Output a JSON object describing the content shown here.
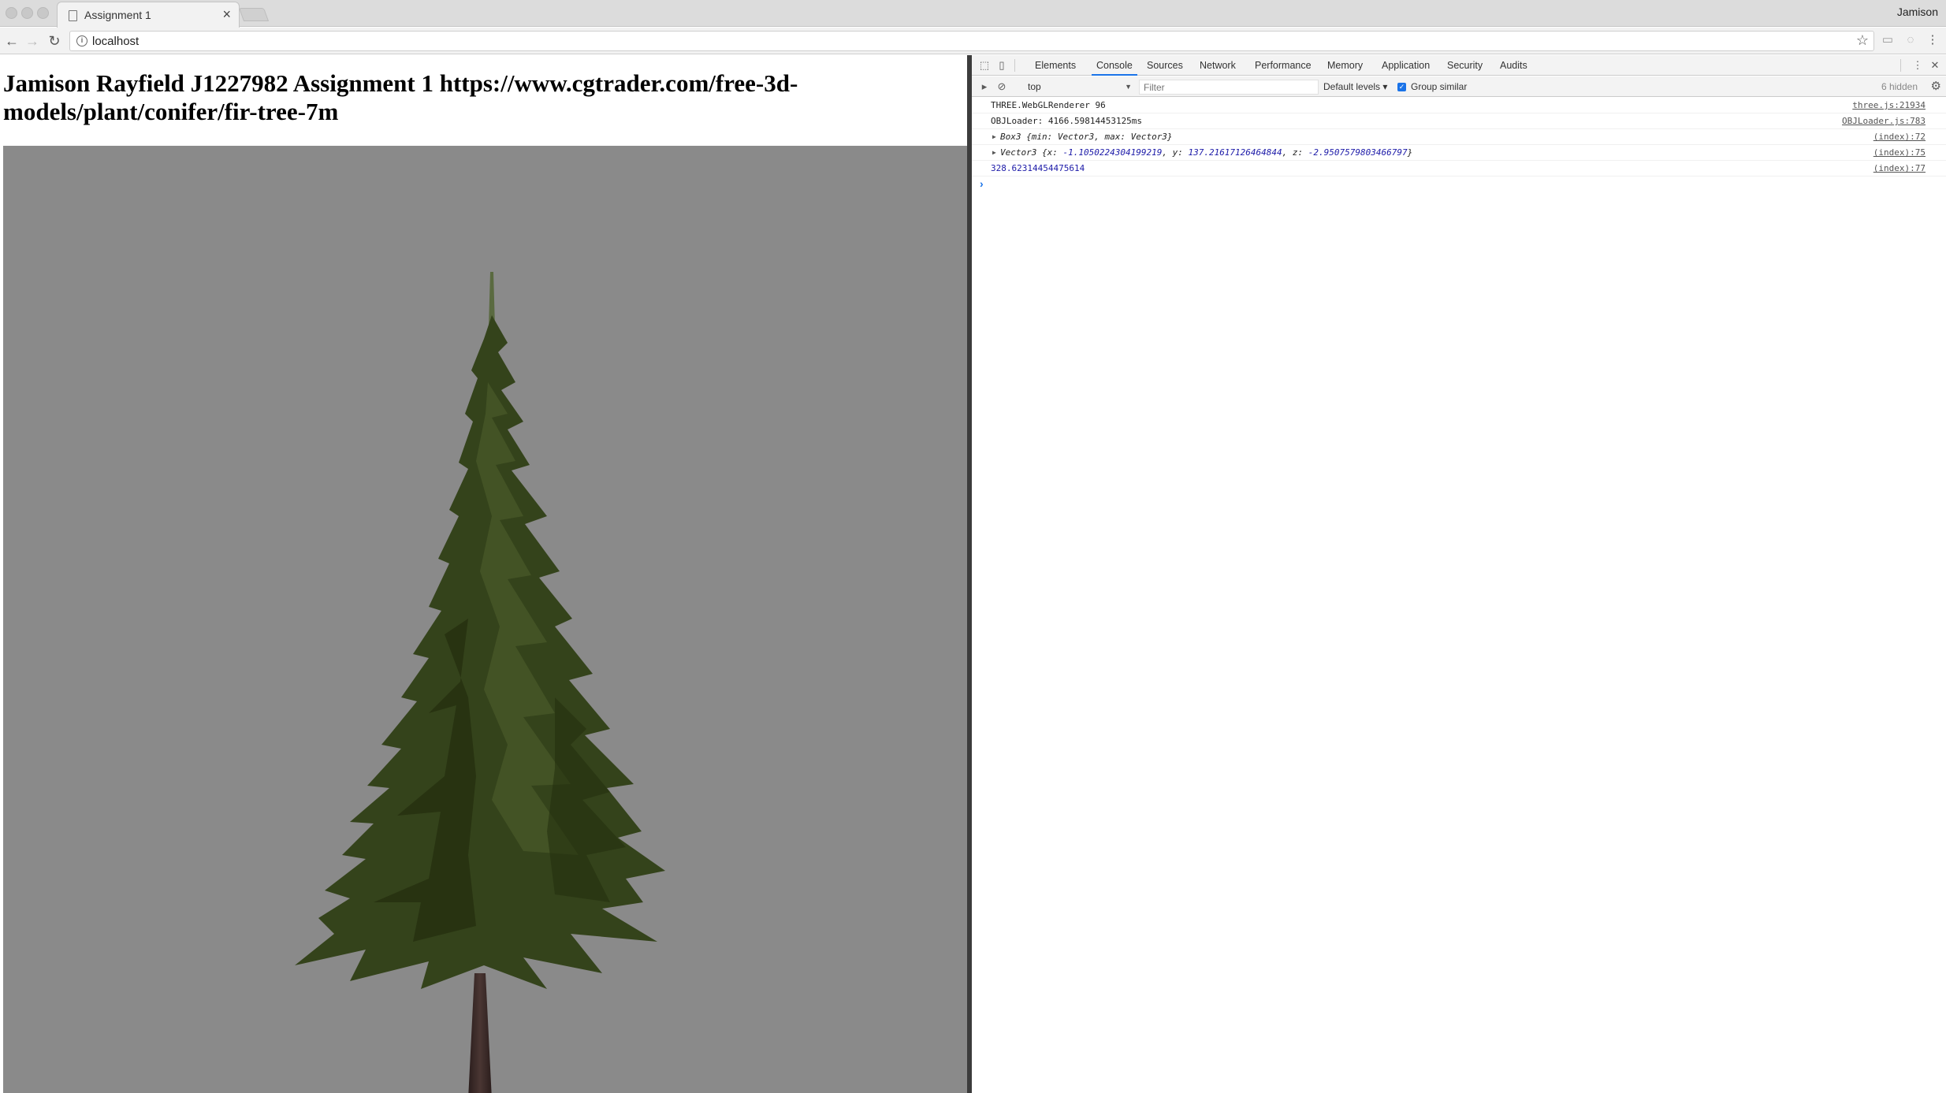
{
  "browser": {
    "tab_title": "Assignment 1",
    "tab_close": "×",
    "profile_name": "Jamison",
    "url": "localhost"
  },
  "page": {
    "heading": "Jamison Rayfield J1227982 Assignment 1 https://www.cgtrader.com/free-3d-models/plant/conifer/fir-tree-7m",
    "viewport_background": "#8a8a8a"
  },
  "devtools": {
    "tabs": [
      "Elements",
      "Console",
      "Sources",
      "Network",
      "Performance",
      "Memory",
      "Application",
      "Security",
      "Audits"
    ],
    "active_tab": "Console",
    "context": "top",
    "filter_placeholder": "Filter",
    "levels": "Default levels ▾",
    "group_similar": "Group similar",
    "hidden_count": "6 hidden",
    "console_rows": [
      {
        "text": "THREE.WebGLRenderer 96",
        "source": "three.js:21934"
      },
      {
        "text": "OBJLoader: 4166.59814453125ms",
        "source": "OBJLoader.js:783"
      },
      {
        "prefix": "Box3 ",
        "text": "{min: Vector3, max: Vector3}",
        "source": "(index):72"
      },
      {
        "prefix": "Vector3 ",
        "x": "-1.1050224304199219",
        "y": "137.21617126464844",
        "z": "-2.9507579803466797",
        "source": "(index):75"
      },
      {
        "text": "328.62314454475614",
        "source": "(index):77"
      }
    ],
    "prompt": "›"
  },
  "colors": {
    "accent": "#1a73e8",
    "number": "#1c1aa8",
    "foliage": "#3a4a1e",
    "trunk": "#3b2a26"
  }
}
